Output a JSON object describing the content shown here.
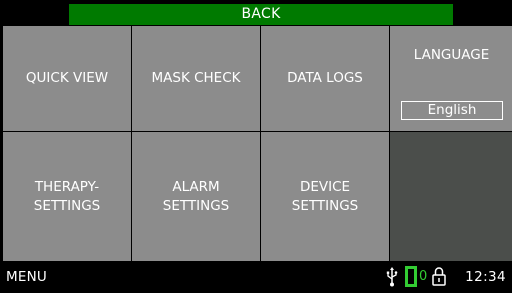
{
  "header": {
    "back_label": "BACK"
  },
  "tiles": {
    "quick_view": "QUICK VIEW",
    "mask_check": "MASK CHECK",
    "data_logs": "DATA LOGS",
    "language_label": "LANGUAGE",
    "language_value": "English",
    "therapy_line1": "THERAPY-",
    "therapy_line2": "SETTINGS",
    "alarm_line1": "ALARM",
    "alarm_line2": "SETTINGS",
    "device_line1": "DEVICE",
    "device_line2": "SETTINGS"
  },
  "status": {
    "menu_label": "MENU",
    "battery_count": "0",
    "time": "12:34",
    "icons": [
      "usb-icon",
      "battery-icon",
      "lock-icon"
    ]
  },
  "colors": {
    "back_green": "#007a00",
    "tile_gray": "#8c8c8c",
    "tile_dark": "#4b4e4b",
    "battery_green": "#33cc33"
  }
}
